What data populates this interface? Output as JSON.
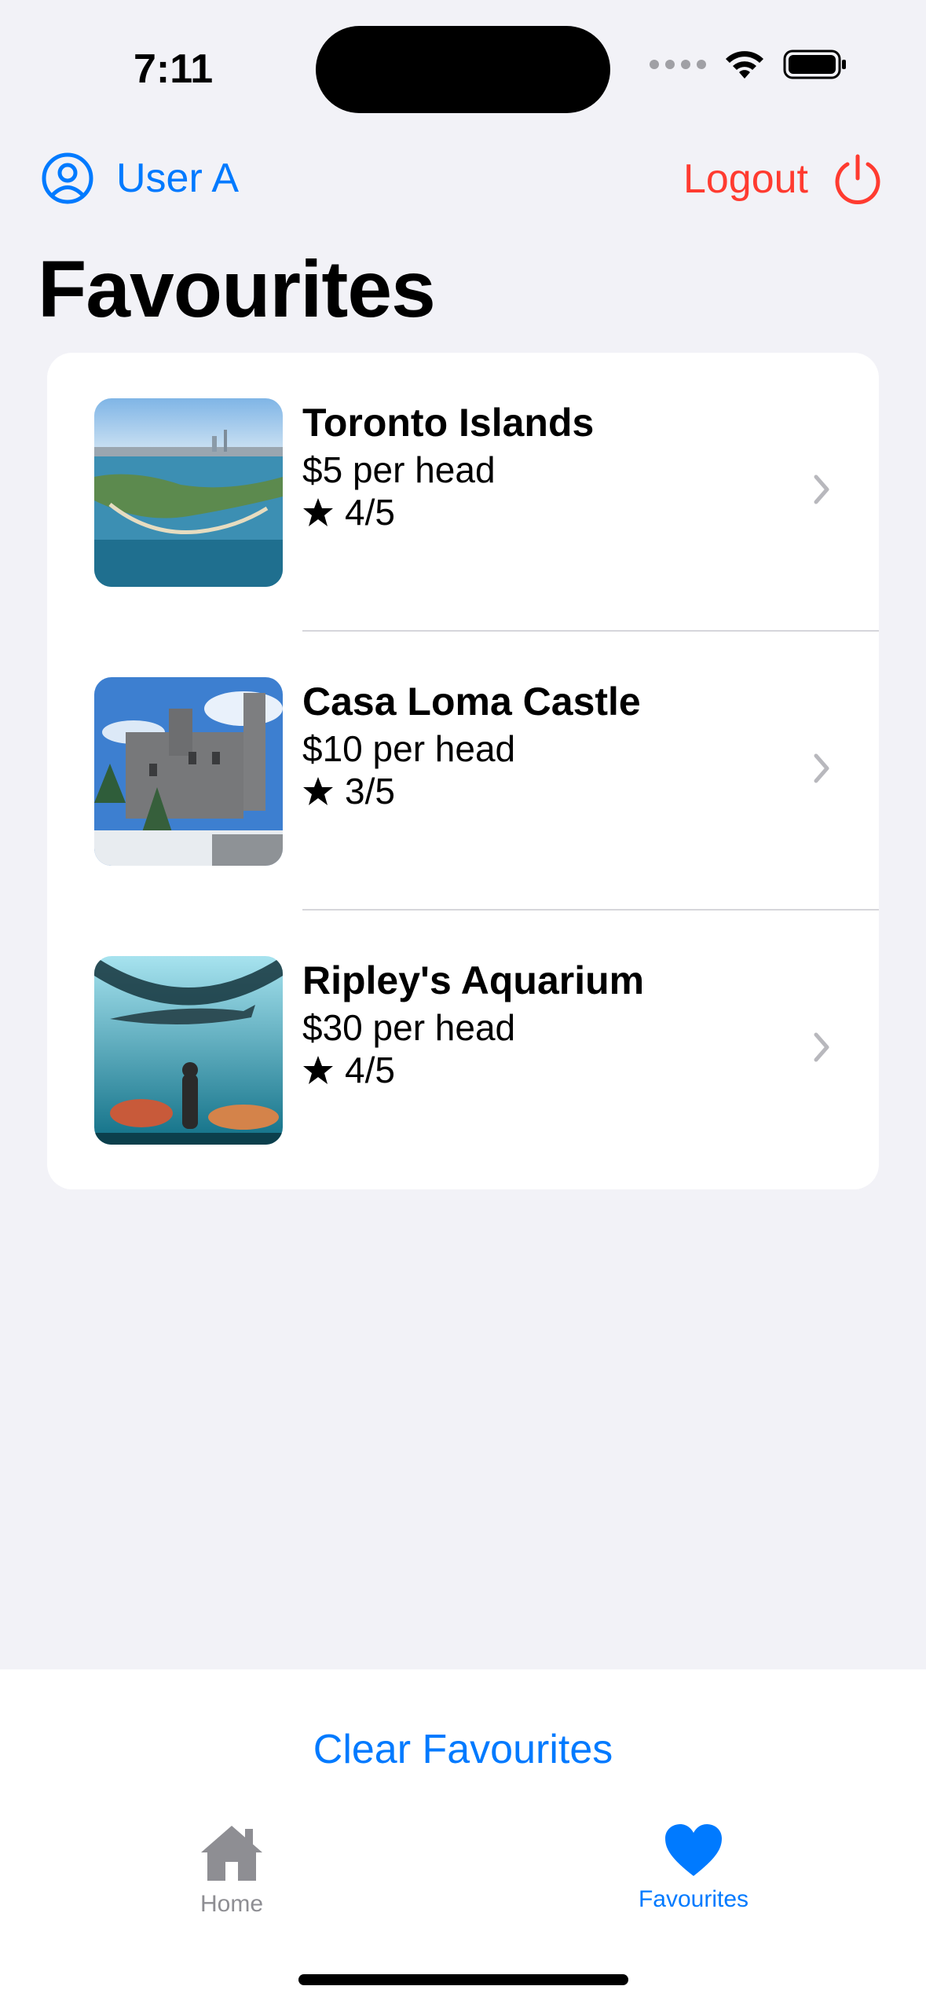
{
  "status_bar": {
    "time": "7:11"
  },
  "header": {
    "user_label": "User A",
    "logout_label": "Logout"
  },
  "page": {
    "title": "Favourites"
  },
  "favourites": [
    {
      "name": "Toronto Islands",
      "price": "$5 per head",
      "rating": "4/5",
      "thumb": "aerial-islands-photo"
    },
    {
      "name": "Casa Loma Castle",
      "price": "$10 per head",
      "rating": "3/5",
      "thumb": "castle-photo"
    },
    {
      "name": "Ripley's Aquarium",
      "price": "$30 per head",
      "rating": "4/5",
      "thumb": "aquarium-tunnel-photo"
    }
  ],
  "actions": {
    "clear_label": "Clear Favourites"
  },
  "tab_bar": {
    "tabs": [
      {
        "label": "Home",
        "icon": "house-icon",
        "active": false
      },
      {
        "label": "Favourites",
        "icon": "heart-icon",
        "active": true
      }
    ]
  },
  "colors": {
    "accent": "#007aff",
    "destructive": "#ff3b30",
    "background": "#f2f2f7"
  }
}
